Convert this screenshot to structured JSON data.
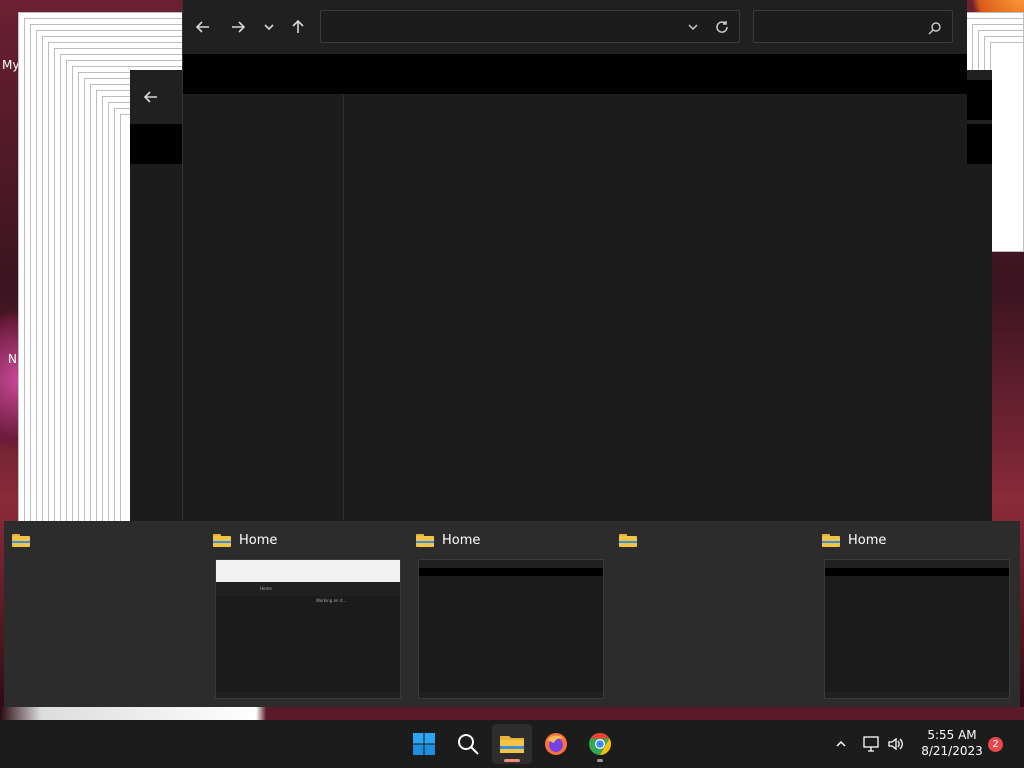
{
  "desktop": {
    "labels": [
      "My",
      "N"
    ],
    "colors": {
      "wallpaper": "#5a1a2a",
      "accent": "#e85a1e"
    }
  },
  "explorer": {
    "nav": {
      "back": "back-arrow-icon",
      "forward": "forward-arrow-icon",
      "recent": "chevron-down-icon",
      "up": "up-arrow-icon"
    },
    "address_value": "",
    "search_value": "",
    "colors": {
      "window_bg": "#1c1c1c",
      "command_bar": "#000000",
      "border": "#3b3b3b"
    }
  },
  "thumbnails": [
    {
      "title": "",
      "has_preview": false
    },
    {
      "title": "Home",
      "has_preview": true,
      "preview_style": "light-titlebar",
      "preview_texts": [
        "Home",
        "Working on it..."
      ]
    },
    {
      "title": "Home",
      "has_preview": true,
      "preview_style": "dark"
    },
    {
      "title": "",
      "has_preview": false
    },
    {
      "title": "Home",
      "has_preview": true,
      "preview_style": "dark"
    }
  ],
  "taskbar": {
    "apps": [
      {
        "name": "start",
        "icon": "windows-logo-icon",
        "active": false
      },
      {
        "name": "search",
        "icon": "search-icon",
        "active": false
      },
      {
        "name": "file-explorer",
        "icon": "folder-icon",
        "active": true
      },
      {
        "name": "firefox",
        "icon": "firefox-icon",
        "active": false
      },
      {
        "name": "chrome",
        "icon": "chrome-icon",
        "active": false
      }
    ],
    "tray": {
      "overflow": "chevron-up-icon",
      "network": "network-icon",
      "volume": "volume-icon"
    },
    "time": "5:55 AM",
    "date": "8/21/2023",
    "notification_count": "2",
    "colors": {
      "active_indicator": "#f08a7a",
      "badge": "#e8474c"
    }
  }
}
